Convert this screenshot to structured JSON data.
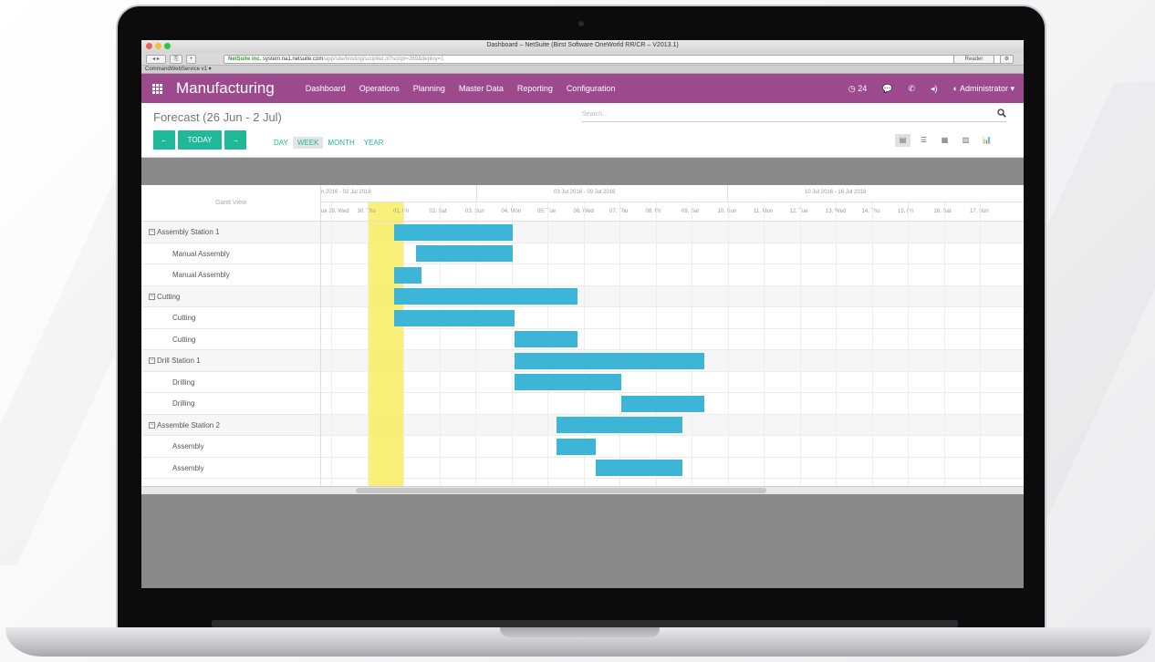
{
  "browser": {
    "window_title": "Dashboard – NetSuite (Birst Software OneWorld RR/CR – V2013.1)",
    "url_secure_label": "NetSuite Inc.",
    "url_host": "system.na1.netsuite.com",
    "url_path": "/app/site/hosting/scriptlet.nl?script=269&deploy=1",
    "reader_label": "Reader",
    "bookmark_label": "CommandWebService  v1 ▾"
  },
  "appbar": {
    "title": "Manufacturing",
    "menu": [
      "Dashboard",
      "Operations",
      "Planning",
      "Master Data",
      "Reporting",
      "Configuration"
    ],
    "notification_count": "24",
    "user": "Administrator ▾"
  },
  "control_panel": {
    "breadcrumb": "Forecast (26 Jun - 2 Jul)",
    "search_placeholder": "Search...",
    "prev_label": "←",
    "today_label": "TODAY",
    "next_label": "→",
    "scales": [
      "DAY",
      "WEEK",
      "MONTH",
      "YEAR"
    ],
    "active_scale": "WEEK",
    "views": [
      "list-view-icon",
      "gantt-view-icon",
      "calendar-view-icon",
      "kanban-view-icon",
      "graph-view-icon"
    ]
  },
  "gantt": {
    "header_label": "Gantt View",
    "weeks": [
      "n 2016 - 02 Jul 2016",
      "03 Jul 2016 - 09 Jul 2016",
      "10 Jul 2016 - 16 Jul 2016"
    ],
    "days": [
      "ue 29, Wed",
      "30, Thu",
      "01, Fri",
      "02, Sat",
      "03, Sun",
      "04, Mon",
      "05, Tue",
      "06, Wed",
      "07, Thu",
      "08, Fri",
      "09, Sat",
      "10, Sun",
      "11, Mon",
      "12, Tue",
      "13, Wed",
      "14, Thu",
      "15, Fri",
      "16, Sat",
      "17, Sun"
    ],
    "today_day_index": 1,
    "rows": [
      {
        "label": "Assembly Station 1",
        "group": true,
        "start": 2,
        "end": 5.3
      },
      {
        "label": "Manual Assembly",
        "group": false,
        "start": 2.6,
        "end": 5.3
      },
      {
        "label": "Manual Assembly",
        "group": false,
        "start": 2,
        "end": 2.75
      },
      {
        "label": "Cutting",
        "group": true,
        "start": 2,
        "end": 7.1
      },
      {
        "label": "Cutting",
        "group": false,
        "start": 2,
        "end": 5.35
      },
      {
        "label": "Cutting",
        "group": false,
        "start": 5.35,
        "end": 7.1
      },
      {
        "label": "Drill Station 1",
        "group": true,
        "start": 5.35,
        "end": 10.6
      },
      {
        "label": "Drilling",
        "group": false,
        "start": 5.35,
        "end": 8.3
      },
      {
        "label": "Drilling",
        "group": false,
        "start": 8.3,
        "end": 10.6
      },
      {
        "label": "Assemble Station 2",
        "group": true,
        "start": 6.5,
        "end": 10
      },
      {
        "label": "Assembly",
        "group": false,
        "start": 6.5,
        "end": 7.6
      },
      {
        "label": "Assembly",
        "group": false,
        "start": 7.6,
        "end": 10
      }
    ]
  },
  "colors": {
    "brand": "#9c4a8d",
    "accent": "#21b799",
    "bar": "#3db5d6",
    "today": "#f7ee6a"
  }
}
